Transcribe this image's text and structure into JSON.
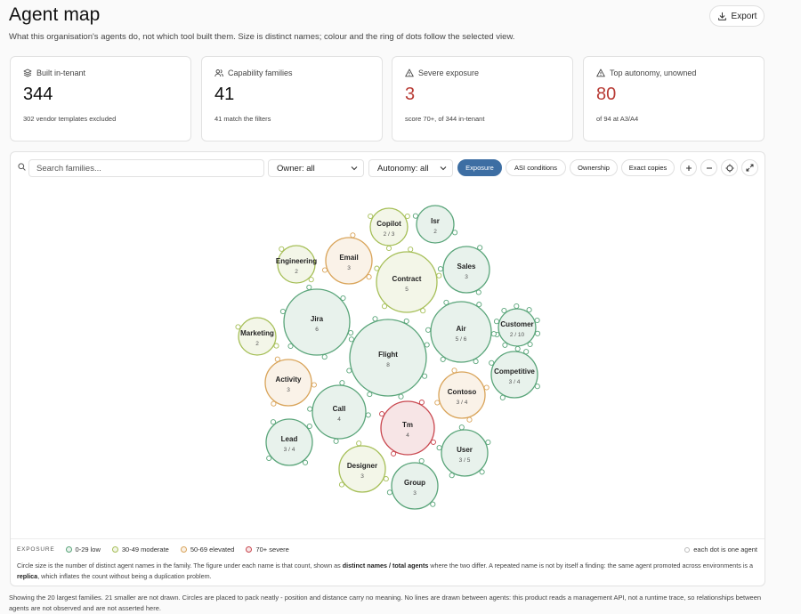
{
  "header": {
    "title": "Agent map",
    "subtitle": "What this organisation's agents do, not which tool built them. Size is distinct names; colour and the ring of dots follow the selected view.",
    "export_label": "Export"
  },
  "cards": [
    {
      "label": "Built in-tenant",
      "value": "344",
      "note": "302 vendor templates excluded",
      "icon": "layers-icon",
      "value_color": "#111111"
    },
    {
      "label": "Capability families",
      "value": "41",
      "note": "41 match the filters",
      "icon": "users-icon",
      "value_color": "#111111"
    },
    {
      "label": "Severe exposure",
      "value": "3",
      "note": "score 70+, of 344 in-tenant",
      "icon": "warning-icon",
      "value_color": "#b83b35"
    },
    {
      "label": "Top autonomy, unowned",
      "value": "80",
      "note": "of 94 at A3/A4",
      "icon": "warning-icon",
      "value_color": "#b83b35"
    }
  ],
  "toolbar": {
    "search_placeholder": "Search families...",
    "owner_select": "Owner: all",
    "autonomy_select": "Autonomy: all",
    "views": [
      "Exposure",
      "ASI conditions",
      "Ownership",
      "Exact copies"
    ],
    "active_view": "Exposure"
  },
  "colors": {
    "low": "#5aa57a",
    "moderate": "#a6bf58",
    "elevated": "#d9a45a",
    "severe": "#c9474f",
    "accent": "#3d6ea3"
  },
  "bubbles": [
    {
      "name": "Copilot",
      "count": "2 / 3",
      "level": "moderate",
      "agents": 3
    },
    {
      "name": "Isr",
      "count": "2",
      "level": "low",
      "agents": 2
    },
    {
      "name": "Engineering",
      "count": "2",
      "level": "moderate",
      "agents": 2
    },
    {
      "name": "Email",
      "count": "3",
      "level": "elevated",
      "agents": 3
    },
    {
      "name": "Sales",
      "count": "3",
      "level": "low",
      "agents": 3
    },
    {
      "name": "Contract",
      "count": "5",
      "level": "moderate",
      "agents": 5
    },
    {
      "name": "Jira",
      "count": "6",
      "level": "low",
      "agents": 6
    },
    {
      "name": "Customer",
      "count": "2 / 10",
      "level": "low",
      "agents": 10
    },
    {
      "name": "Air",
      "count": "5 / 6",
      "level": "low",
      "agents": 6
    },
    {
      "name": "Marketing",
      "count": "2",
      "level": "moderate",
      "agents": 2
    },
    {
      "name": "Flight",
      "count": "8",
      "level": "low",
      "agents": 8
    },
    {
      "name": "Competitive",
      "count": "3 / 4",
      "level": "low",
      "agents": 4
    },
    {
      "name": "Activity",
      "count": "3",
      "level": "elevated",
      "agents": 3
    },
    {
      "name": "Contoso",
      "count": "3 / 4",
      "level": "elevated",
      "agents": 4
    },
    {
      "name": "Call",
      "count": "4",
      "level": "low",
      "agents": 4
    },
    {
      "name": "Tm",
      "count": "4",
      "level": "severe",
      "agents": 4
    },
    {
      "name": "Lead",
      "count": "3 / 4",
      "level": "low",
      "agents": 4
    },
    {
      "name": "User",
      "count": "3 / 5",
      "level": "low",
      "agents": 5
    },
    {
      "name": "Designer",
      "count": "3",
      "level": "moderate",
      "agents": 3
    },
    {
      "name": "Group",
      "count": "3",
      "level": "low",
      "agents": 3
    }
  ],
  "legend": {
    "title": "EXPOSURE",
    "items": [
      {
        "label": "0-29 low",
        "level": "low"
      },
      {
        "label": "30-49 moderate",
        "level": "moderate"
      },
      {
        "label": "50-69 elevated",
        "level": "elevated"
      },
      {
        "label": "70+ severe",
        "level": "severe"
      }
    ],
    "each_dot": "each dot is one agent"
  },
  "explain": {
    "part1": "Circle size is the number of distinct agent names in the family. The figure under each name is that count, shown as ",
    "bold1": "distinct names / total agents",
    "part2": " where the two differ. A repeated name is not by itself a finding: the same agent promoted across environments is a ",
    "bold2": "replica",
    "part3": ", which inflates the count without being a duplication problem."
  },
  "footer": "Showing the 20 largest families. 21 smaller are not drawn. Circles are placed to pack neatly - position and distance carry no meaning. No lines are drawn between agents: this product reads a management API, not a runtime trace, so relationships between agents are not observed and are not asserted here."
}
